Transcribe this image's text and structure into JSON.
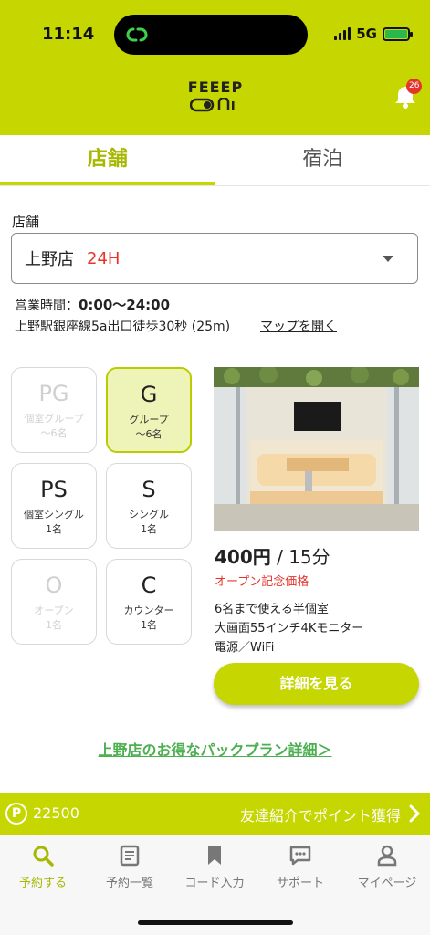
{
  "status_bar": {
    "time": "11:14",
    "network": "5G"
  },
  "header": {
    "logo_text": "FEEEP",
    "notification_count": "26"
  },
  "tabs": [
    {
      "label": "店舗",
      "active": true
    },
    {
      "label": "宿泊",
      "active": false
    }
  ],
  "store": {
    "label": "店舗",
    "selected_name": "上野店",
    "selected_hours": "24H",
    "hours_label": "営業時間：",
    "hours_value": "0:00〜24:00",
    "access": "上野駅銀座線5a出口徒歩30秒 (25m)",
    "map_link": "マップを開く"
  },
  "seats": [
    {
      "code": "PG",
      "line1": "個室グループ",
      "line2": "〜6名",
      "state": "disabled"
    },
    {
      "code": "G",
      "line1": "グループ",
      "line2": "〜6名",
      "state": "selected"
    },
    {
      "code": "PS",
      "line1": "個室シングル",
      "line2": "1名",
      "state": "normal"
    },
    {
      "code": "S",
      "line1": "シングル",
      "line2": "1名",
      "state": "normal"
    },
    {
      "code": "O",
      "line1": "オープン",
      "line2": "1名",
      "state": "disabled"
    },
    {
      "code": "C",
      "line1": "カウンター",
      "line2": "1名",
      "state": "normal"
    }
  ],
  "plan": {
    "price": "400円",
    "duration": " / 15分",
    "note": "オープン記念価格",
    "features": [
      "6名まで使える半個室",
      "大画面55インチ4Kモニター",
      "電源／WiFi"
    ],
    "detail_button": "詳細を見る"
  },
  "pack_link": "上野店のお得なパックプラン詳細＞",
  "points": {
    "icon_letter": "P",
    "value": "22500",
    "referral": "友達紹介でポイント獲得"
  },
  "bottom_nav": [
    {
      "label": "予約する",
      "icon": "search-icon",
      "active": true
    },
    {
      "label": "予約一覧",
      "icon": "list-icon",
      "active": false
    },
    {
      "label": "コード入力",
      "icon": "bookmark-icon",
      "active": false
    },
    {
      "label": "サポート",
      "icon": "chat-icon",
      "active": false
    },
    {
      "label": "マイページ",
      "icon": "person-icon",
      "active": false
    }
  ],
  "colors": {
    "brand": "#c5d600",
    "accent_text": "#a6b800",
    "alert": "#e5342a",
    "link_green": "#4caf50"
  }
}
